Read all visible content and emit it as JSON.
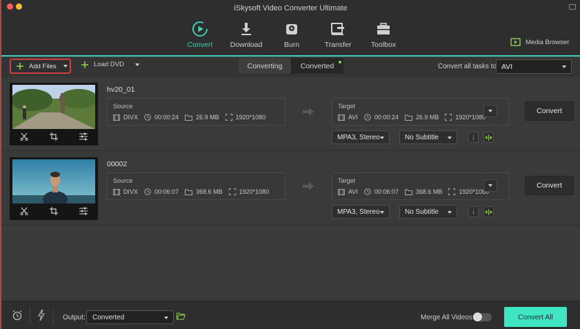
{
  "app": {
    "title": "iSkysoft Video Converter Ultimate"
  },
  "nav": [
    {
      "label": "Convert",
      "icon": "convert-icon",
      "active": true
    },
    {
      "label": "Download",
      "icon": "download-icon"
    },
    {
      "label": "Burn",
      "icon": "burn-icon"
    },
    {
      "label": "Transfer",
      "icon": "transfer-icon"
    },
    {
      "label": "Toolbox",
      "icon": "toolbox-icon"
    }
  ],
  "media_browser": {
    "label": "Media Browser"
  },
  "toolbar": {
    "add_files": "Add Files",
    "load_dvd": "Load DVD",
    "tabs": [
      {
        "label": "Converting",
        "active": true
      },
      {
        "label": "Converted"
      }
    ],
    "convert_all_label": "Convert all tasks to:",
    "convert_all_value": "AVI"
  },
  "files": [
    {
      "name": "hv20_01",
      "source": {
        "label": "Source",
        "format": "DIVX",
        "duration": "00:00:24",
        "size": "26.9 MB",
        "resolution": "1920*1080"
      },
      "target": {
        "label": "Target",
        "format": "AVI",
        "duration": "00:00:24",
        "size": "26.9 MB",
        "resolution": "1920*1080"
      },
      "audio": "MPA3, Stereo",
      "subtitle": "No Subtitle",
      "convert": "Convert"
    },
    {
      "name": "00002",
      "source": {
        "label": "Source",
        "format": "DIVX",
        "duration": "00:06:07",
        "size": "368.6 MB",
        "resolution": "1920*1080"
      },
      "target": {
        "label": "Target",
        "format": "AVI",
        "duration": "00:06:07",
        "size": "368.6 MB",
        "resolution": "1920*1080"
      },
      "audio": "MPA3, Stereo",
      "subtitle": "No Subtitle",
      "convert": "Convert"
    }
  ],
  "bottom": {
    "output_label": "Output:",
    "output_value": "Converted",
    "merge_label": "Merge All Videos:",
    "merge_on": false,
    "convert_all": "Convert All"
  },
  "colors": {
    "accent": "#3ecfb4",
    "convert_all_bg": "#3ee6c3",
    "highlight_border": "#d03e45",
    "status_dot": "#8fd14f"
  }
}
